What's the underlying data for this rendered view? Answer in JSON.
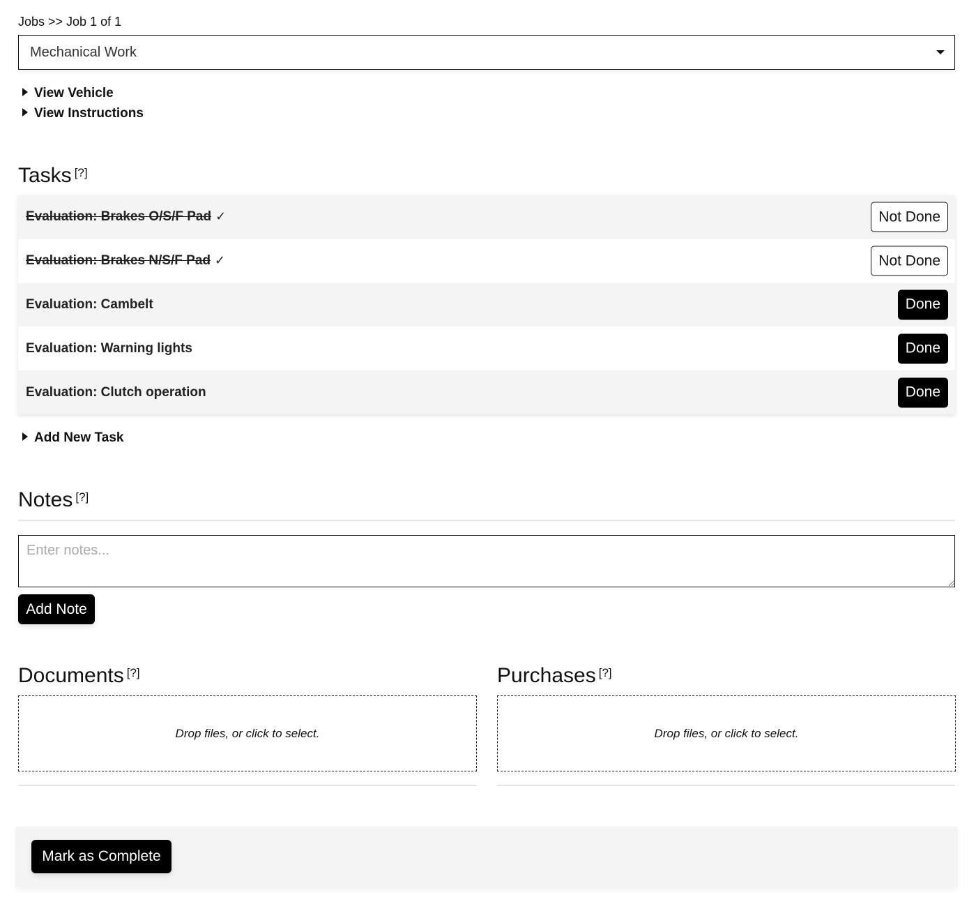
{
  "breadcrumb": "Jobs >> Job 1 of 1",
  "job_select": {
    "value": "Mechanical Work",
    "icon": "chevron-down-icon"
  },
  "disclosures": {
    "view_vehicle": "View Vehicle",
    "view_instructions": "View Instructions"
  },
  "tasks": {
    "title": "Tasks",
    "help": "[?]",
    "items": [
      {
        "label": "Evaluation: Brakes O/S/F Pad",
        "done": true,
        "check": "✓",
        "button": "Not Done"
      },
      {
        "label": "Evaluation: Brakes N/S/F Pad",
        "done": true,
        "check": "✓",
        "button": "Not Done"
      },
      {
        "label": "Evaluation: Cambelt",
        "done": false,
        "button": "Done"
      },
      {
        "label": "Evaluation: Warning lights",
        "done": false,
        "button": "Done"
      },
      {
        "label": "Evaluation: Clutch operation",
        "done": false,
        "button": "Done"
      }
    ],
    "add_new": "Add New Task"
  },
  "notes": {
    "title": "Notes",
    "help": "[?]",
    "placeholder": "Enter notes...",
    "add_button": "Add Note"
  },
  "documents": {
    "title": "Documents",
    "help": "[?]",
    "drop_text": "Drop files, or click to select."
  },
  "purchases": {
    "title": "Purchases",
    "help": "[?]",
    "drop_text": "Drop files, or click to select."
  },
  "footer": {
    "complete_button": "Mark as Complete"
  }
}
